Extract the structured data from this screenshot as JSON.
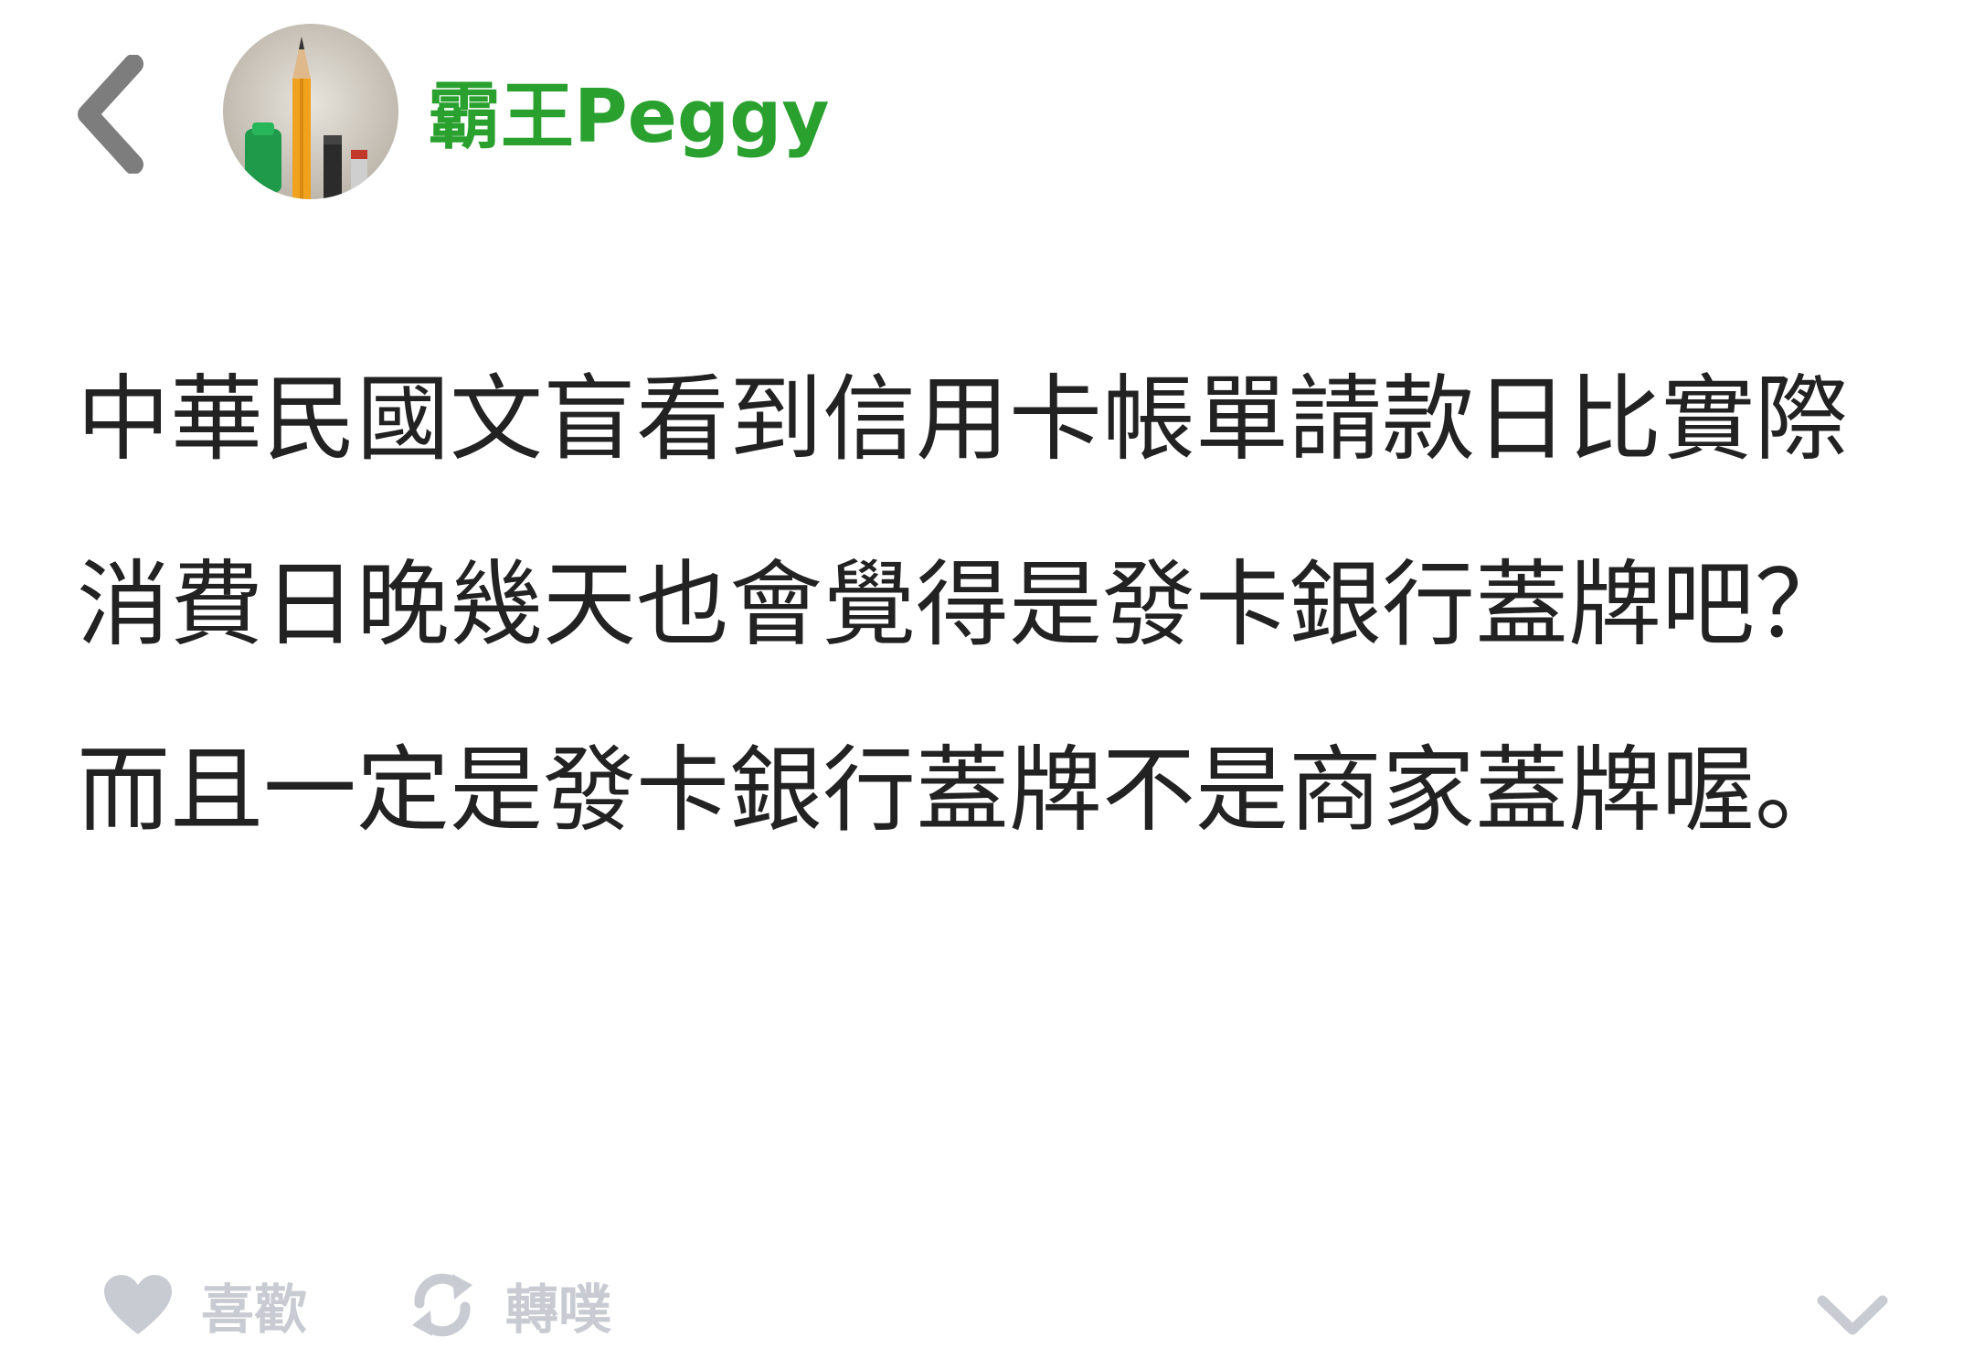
{
  "header": {
    "username": "霸王Peggy",
    "username_color": "#2aa12e",
    "back_icon": "chevron-left-icon",
    "avatar_description_icon": "pencil-avatar"
  },
  "post": {
    "paragraphs": [
      "中華民國文盲看到信用卡帳單請款日比實際消費日晚幾天也會覺得是發卡銀行蓋牌吧？",
      "而且一定是發卡銀行蓋牌不是商家蓋牌喔。"
    ],
    "text_color": "#222222"
  },
  "actions": {
    "like_label": "喜歡",
    "like_icon": "heart-icon",
    "replurk_label": "轉噗",
    "replurk_icon": "replurk-icon",
    "expand_icon": "chevron-down-icon",
    "icon_color": "#c9cbd3"
  }
}
